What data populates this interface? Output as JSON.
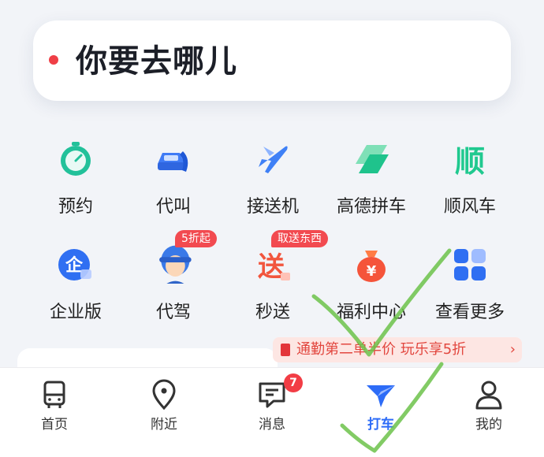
{
  "search": {
    "prompt": "你要去哪儿"
  },
  "services": [
    {
      "label": "预约",
      "icon": "stopwatch-icon"
    },
    {
      "label": "代叫",
      "icon": "car-phone-icon"
    },
    {
      "label": "接送机",
      "icon": "airplane-icon"
    },
    {
      "label": "高德拼车",
      "icon": "carpool-icon"
    },
    {
      "label": "顺风车",
      "icon": "shunfeng-icon"
    },
    {
      "label": "企业版",
      "icon": "enterprise-icon"
    },
    {
      "label": "代驾",
      "icon": "driver-avatar-icon",
      "badge": "5折起"
    },
    {
      "label": "秒送",
      "icon": "express-delivery-icon",
      "badge": "取送东西"
    },
    {
      "label": "福利中心",
      "icon": "money-bag-icon"
    },
    {
      "label": "查看更多",
      "icon": "more-grid-icon"
    }
  ],
  "promo": {
    "text": "通勤第二单半价 玩乐享5折"
  },
  "tabs": [
    {
      "label": "首页",
      "icon": "bus-icon"
    },
    {
      "label": "附近",
      "icon": "location-pin-icon"
    },
    {
      "label": "消息",
      "icon": "message-icon",
      "count": "7"
    },
    {
      "label": "打车",
      "icon": "taxi-plane-icon",
      "active": true
    },
    {
      "label": "我的",
      "icon": "profile-icon"
    }
  ],
  "colors": {
    "accent": "#2d6cf7",
    "badge": "#f24a50",
    "check": "#6cc24a"
  }
}
